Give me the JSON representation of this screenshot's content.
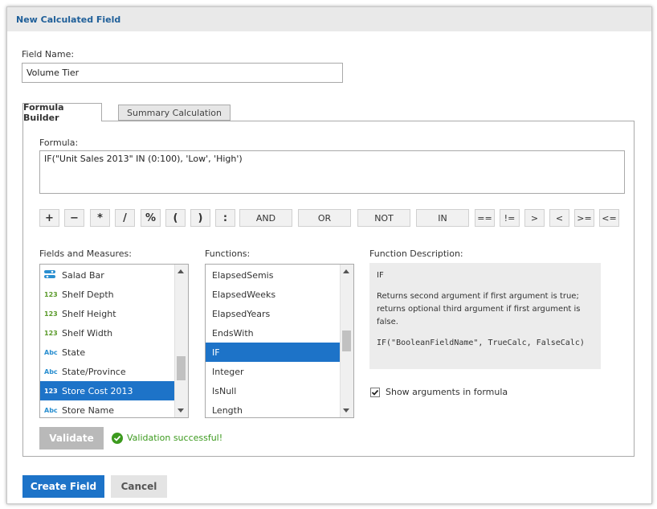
{
  "dialog": {
    "title": "New Calculated Field"
  },
  "field_name": {
    "label": "Field Name:",
    "value": "Volume Tier"
  },
  "tabs": [
    {
      "label": "Formula Builder"
    },
    {
      "label": "Summary Calculation"
    }
  ],
  "formula": {
    "label": "Formula:",
    "value": "IF(\"Unit Sales 2013\" IN (0:100), 'Low', 'High')"
  },
  "operators": [
    "+",
    "−",
    "*",
    "/",
    "%",
    "(",
    ")",
    ":",
    "AND",
    "OR",
    "NOT",
    "IN",
    "==",
    "!=",
    ">",
    "<",
    ">=",
    "<="
  ],
  "fields": {
    "label": "Fields and Measures:",
    "items": [
      {
        "icon": "toggle-icon",
        "label": "Salad Bar"
      },
      {
        "icon": "123",
        "label": "Shelf Depth"
      },
      {
        "icon": "123",
        "label": "Shelf Height"
      },
      {
        "icon": "123",
        "label": "Shelf Width"
      },
      {
        "icon": "Abc",
        "label": "State"
      },
      {
        "icon": "Abc",
        "label": "State/Province"
      },
      {
        "icon": "123",
        "label": "Store Cost 2013",
        "selected": true
      },
      {
        "icon": "Abc",
        "label": "Store Name"
      }
    ]
  },
  "functions": {
    "label": "Functions:",
    "items": [
      {
        "label": "ElapsedSemis"
      },
      {
        "label": "ElapsedWeeks"
      },
      {
        "label": "ElapsedYears"
      },
      {
        "label": "EndsWith"
      },
      {
        "label": "IF",
        "selected": true
      },
      {
        "label": "Integer"
      },
      {
        "label": "IsNull"
      },
      {
        "label": "Length"
      }
    ]
  },
  "description": {
    "label": "Function Description:",
    "name": "IF",
    "text": "Returns second argument if first argument is true; returns optional third argument if first argument is false.",
    "syntax": "IF(\"BooleanFieldName\", TrueCalc, FalseCalc)"
  },
  "show_arguments": {
    "label": "Show arguments in formula",
    "checked": true
  },
  "validate": {
    "label": "Validate",
    "status": "Validation successful!"
  },
  "footer": {
    "create_label": "Create Field",
    "cancel_label": "Cancel"
  },
  "colors": {
    "accent": "#1d73c8",
    "success": "#3c9a1e",
    "title": "#1f5f99"
  }
}
